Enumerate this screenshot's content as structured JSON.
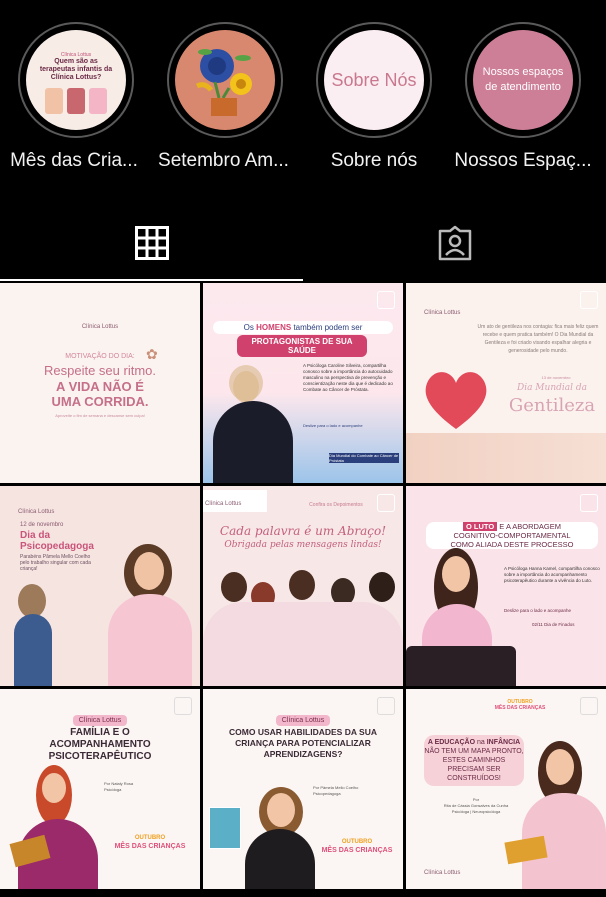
{
  "highlights": [
    {
      "label": "Mês das Cria...",
      "cover_text": "Quem são as terapeutas infantis da Clínica Lottus?",
      "cover_tag": "Clínica Lottus"
    },
    {
      "label": "Setembro Am...",
      "cover_icon": "flowers-icon"
    },
    {
      "label": "Sobre nós",
      "cover_text": "Sobre Nós"
    },
    {
      "label": "Nossos Espaç...",
      "cover_text": "Nossos espaços de atendimento"
    }
  ],
  "tabs": [
    {
      "name": "grid",
      "icon": "grid-icon",
      "active": true
    },
    {
      "name": "tagged",
      "icon": "tagged-person-icon",
      "active": false
    }
  ],
  "posts": [
    {
      "brand": "Clínica Lottus",
      "kicker": "MOTIVAÇÃO DO DIA:",
      "line1": "Respeite seu ritmo.",
      "line2": "A VIDA NÃO É UMA CORRIDA.",
      "caption": "Aproveite o fim de semana e descanse sem culpa!"
    },
    {
      "title_pre": "Os",
      "title_em": "HOMENS",
      "title_post": "também podem ser",
      "title_line2": "PROTAGONISTAS DE SUA SAÚDE",
      "body_name": "Caroline Silveira",
      "body": "A Psicóloga Caroline Silveira, compartilha conosco sobre a importância do autocuidado masculino na perspectiva de prevenção e conscientização neste dia que é dedicado ao Combate ao Câncer de Próstata.",
      "cta": "Deslize para o lado e acompanhe",
      "tag": "Dia Mundial do Combate ao Câncer de Próstata"
    },
    {
      "brand": "Clínica Lottus",
      "body": "Um ato de gentileza nos contagia: fica mais feliz quem recebe e quem pratica também! O Dia Mundial da Gentileza e foi criado visando espalhar alegria e generosidade pelo mundo.",
      "date": "13 de novembro",
      "script": "Dia Mundial da",
      "title": "Gentileza"
    },
    {
      "brand": "Clínica Lottus",
      "date": "12 de novembro",
      "title": "Dia da Psicopedagoga",
      "body": "Parabéns Pâmela Mello Coelho pelo trabalho singular com cada criança!"
    },
    {
      "brand": "Clínica Lottus",
      "tag": "Confira os Depoimentos",
      "script1": "Cada palavra é um Abraço!",
      "script2": "Obrigada pelas mensagens lindas!"
    },
    {
      "title_em": "O LUTO",
      "title1": "E A ABORDAGEM",
      "title2": "COGNITIVO-COMPORTAMENTAL",
      "title3": "COMO ALIADA DESTE PROCESSO",
      "body": "A Psicóloga Hanna Kamel, compartilha conosco sobre a importância do acompanhamento psicoterapêutico durante a vivência do Luto.",
      "cta": "Deslize para o lado e acompanhe",
      "date": "02/11 Dia de Finados"
    },
    {
      "brand": "Clínica Lottus",
      "title": "FAMÍLIA E O ACOMPANHAMENTO PSICOTERAPÊUTICO",
      "author": "Por Nataly Rosa",
      "role": "Psicóloga",
      "badge1": "OUTUBRO",
      "badge2": "MÊS DAS CRIANÇAS"
    },
    {
      "brand": "Clínica Lottus",
      "title": "COMO USAR HABILIDADES DA SUA CRIANÇA PARA POTENCIALIZAR APRENDIZAGENS?",
      "author": "Por Pâmela Mello Coelho",
      "role": "Psicopedagoga",
      "badge1": "OUTUBRO",
      "badge2": "MÊS DAS CRIANÇAS"
    },
    {
      "badge1": "OUTUBRO",
      "badge2": "MÊS DAS CRIANÇAS",
      "body_em": "A EDUCAÇÃO",
      "body_pre": "na",
      "body_em2": "INFÂNCIA",
      "body": "NÃO TEM UM MAPA PRONTO, ESTES CAMINHOS PRECISAM SER CONSTRUÍDOS!",
      "author": "Por",
      "author_name": "Rita de Cássia Gonsalves da Cunha",
      "role": "Psicóloga | Neuropsicóloga",
      "brand": "Clínica Lottus"
    }
  ]
}
